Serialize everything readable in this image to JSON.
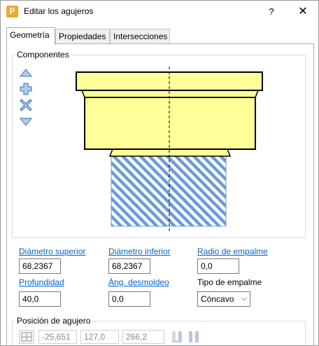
{
  "window": {
    "title": "Editar los agujeros",
    "app_icon_letter": "P",
    "help_glyph": "?",
    "close_glyph": "✕"
  },
  "tabs": [
    {
      "label": "Geometría",
      "active": true
    },
    {
      "label": "Propiedades",
      "active": false
    },
    {
      "label": "Intersecciones",
      "active": false
    }
  ],
  "components": {
    "label": "Componentes",
    "buttons": [
      "move-up-icon",
      "add-icon",
      "delete-icon",
      "move-down-icon"
    ]
  },
  "fields": {
    "diametro_superior": {
      "label": "Diámetro superior",
      "value": "68,2367"
    },
    "diametro_inferior": {
      "label": "Diámetro inferior",
      "value": "68,2367"
    },
    "radio_empalme": {
      "label": "Radio de empalme",
      "value": "0,0"
    },
    "profundidad": {
      "label": "Profundidad",
      "value": "40,0"
    },
    "ang_desmoldeo": {
      "label": "Áng. desmoldeo",
      "value": "0,0"
    },
    "tipo_empalme": {
      "label": "Tipo de empalme",
      "value": "Cóncavo"
    }
  },
  "position": {
    "label": "Posición de agujero",
    "x": "-25,651",
    "y": "127,0",
    "z": "266,2"
  },
  "colors": {
    "shape_fill": "#ffff99",
    "hatch": "#6b9bd8",
    "link": "#0066cc"
  }
}
